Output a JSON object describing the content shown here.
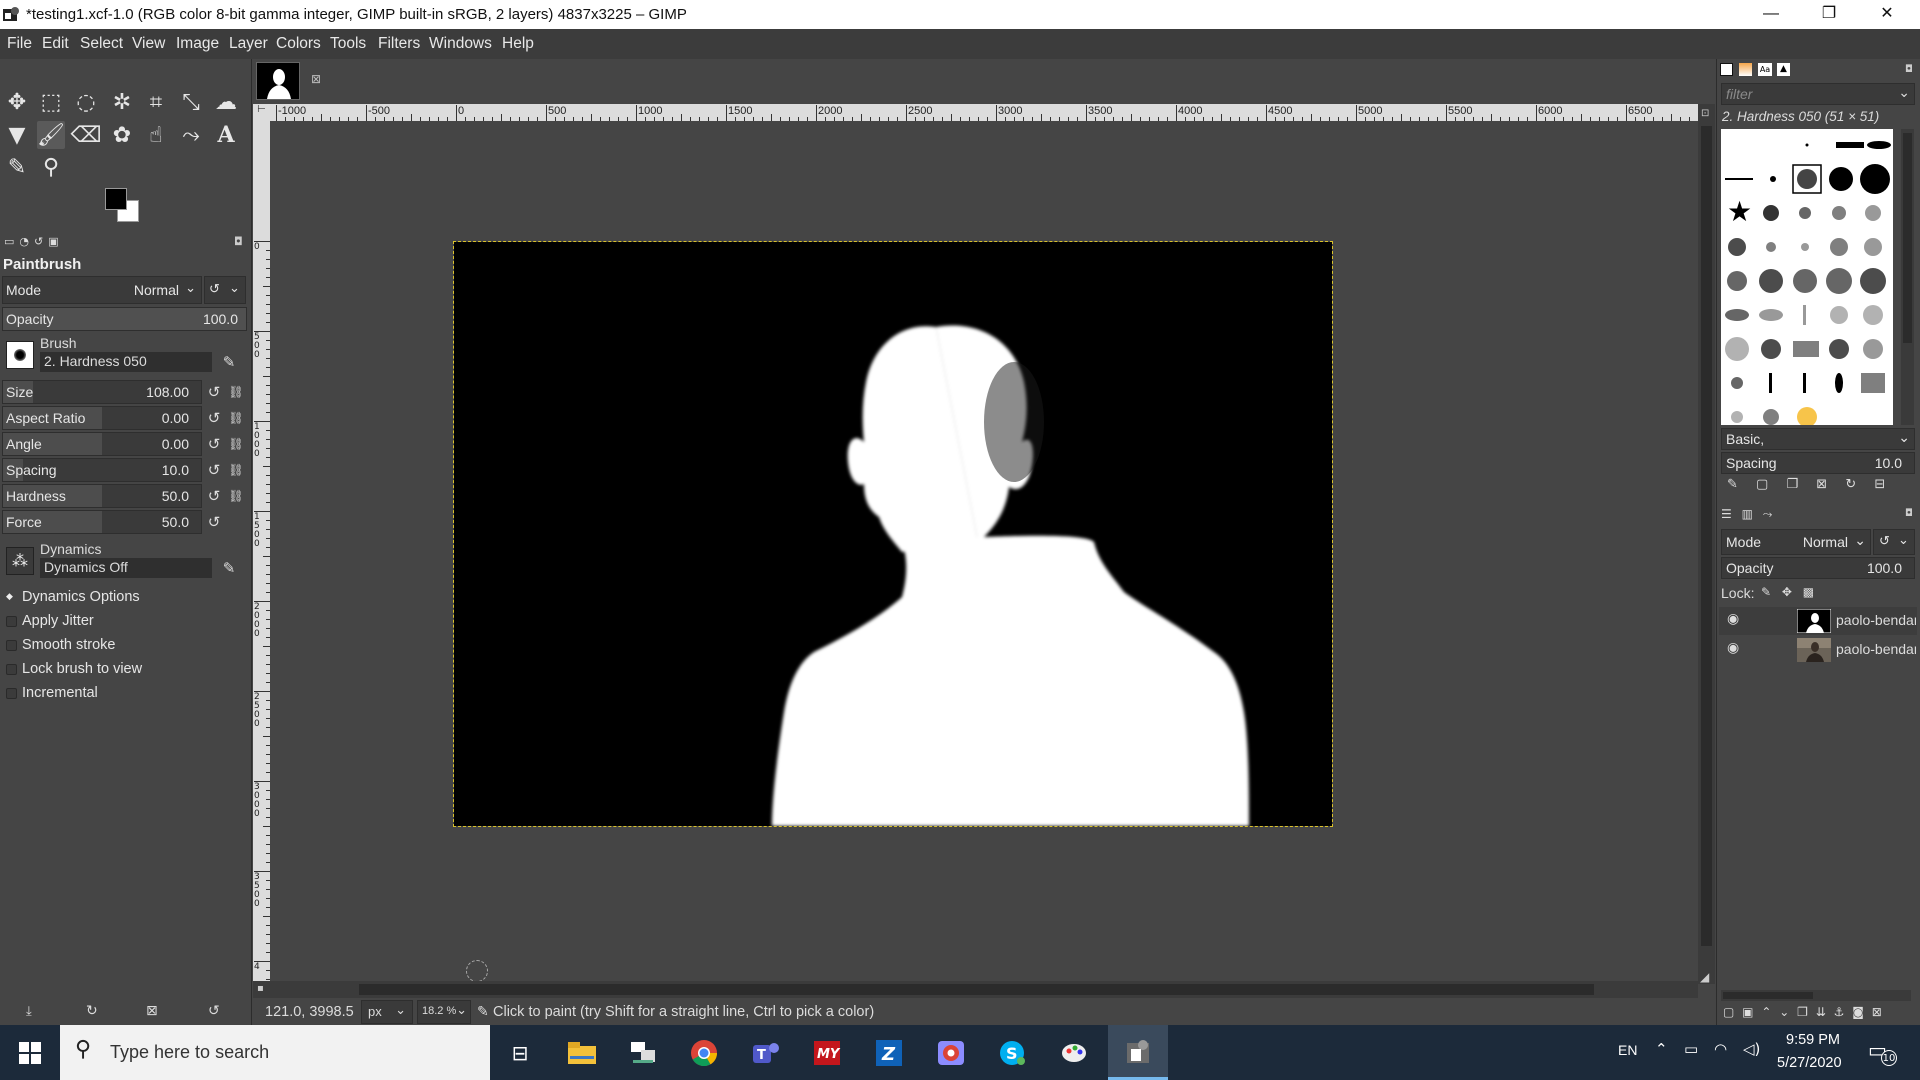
{
  "window": {
    "title": "*testing1.xcf-1.0 (RGB color 8-bit gamma integer, GIMP built-in sRGB, 2 layers) 4837x3225 – GIMP",
    "minimize": "—",
    "maximize": "❐",
    "close": "✕"
  },
  "menu": [
    "File",
    "Edit",
    "Select",
    "View",
    "Image",
    "Layer",
    "Colors",
    "Tools",
    "Filters",
    "Windows",
    "Help"
  ],
  "tool_options": {
    "tool_name": "Paintbrush",
    "mode_label": "Mode",
    "mode_value": "Normal",
    "opacity_label": "Opacity",
    "opacity_value": "100.0",
    "brush_label": "Brush",
    "brush_name": "2. Hardness 050",
    "sliders": [
      {
        "label": "Size",
        "value": "108.00",
        "fill": 0.15
      },
      {
        "label": "Aspect Ratio",
        "value": "0.00",
        "fill": 0.5
      },
      {
        "label": "Angle",
        "value": "0.00",
        "fill": 0.5
      },
      {
        "label": "Spacing",
        "value": "10.0",
        "fill": 0.1
      },
      {
        "label": "Hardness",
        "value": "50.0",
        "fill": 0.5
      },
      {
        "label": "Force",
        "value": "50.0",
        "fill": 0.5
      }
    ],
    "dynamics_label": "Dynamics",
    "dynamics_value": "Dynamics Off",
    "dynamics_options": "Dynamics Options",
    "checkboxes": [
      "Apply Jitter",
      "Smooth stroke",
      "Lock brush to view",
      "Incremental"
    ]
  },
  "rulers": {
    "h_labels": [
      "-1000",
      "-500",
      "0",
      "500",
      "1000",
      "1500",
      "2000",
      "2500",
      "3000",
      "3500",
      "4000",
      "4500",
      "5000",
      "5500",
      "6000",
      "6500"
    ],
    "v_labels": [
      "0",
      "500",
      "1000",
      "1500",
      "2000",
      "2500",
      "3000",
      "3500",
      "4"
    ]
  },
  "status": {
    "coords": "121.0, 3998.5",
    "unit": "px",
    "zoom": "18.2 %",
    "message": "Click to paint (try Shift for a straight line, Ctrl to pick a color)"
  },
  "brushes": {
    "filter_placeholder": "filter",
    "brush_title": "2. Hardness 050 (51 × 51)",
    "preset": "Basic,",
    "spacing_label": "Spacing",
    "spacing_value": "10.0"
  },
  "layers": {
    "mode_label": "Mode",
    "mode_value": "Normal",
    "opacity_label": "Opacity",
    "opacity_value": "100.0",
    "lock_label": "Lock:",
    "items": [
      {
        "name": "paolo-bendar"
      },
      {
        "name": "paolo-bendar"
      }
    ]
  },
  "taskbar": {
    "search_placeholder": "Type here to search",
    "lang": "EN",
    "time": "9:59 PM",
    "date": "5/27/2020",
    "notifications": "10"
  },
  "colors": {
    "accent": "#3daee9",
    "canvas_bg": "#000000",
    "ui_bg": "#454545",
    "taskbar": "#1c2a3a"
  }
}
